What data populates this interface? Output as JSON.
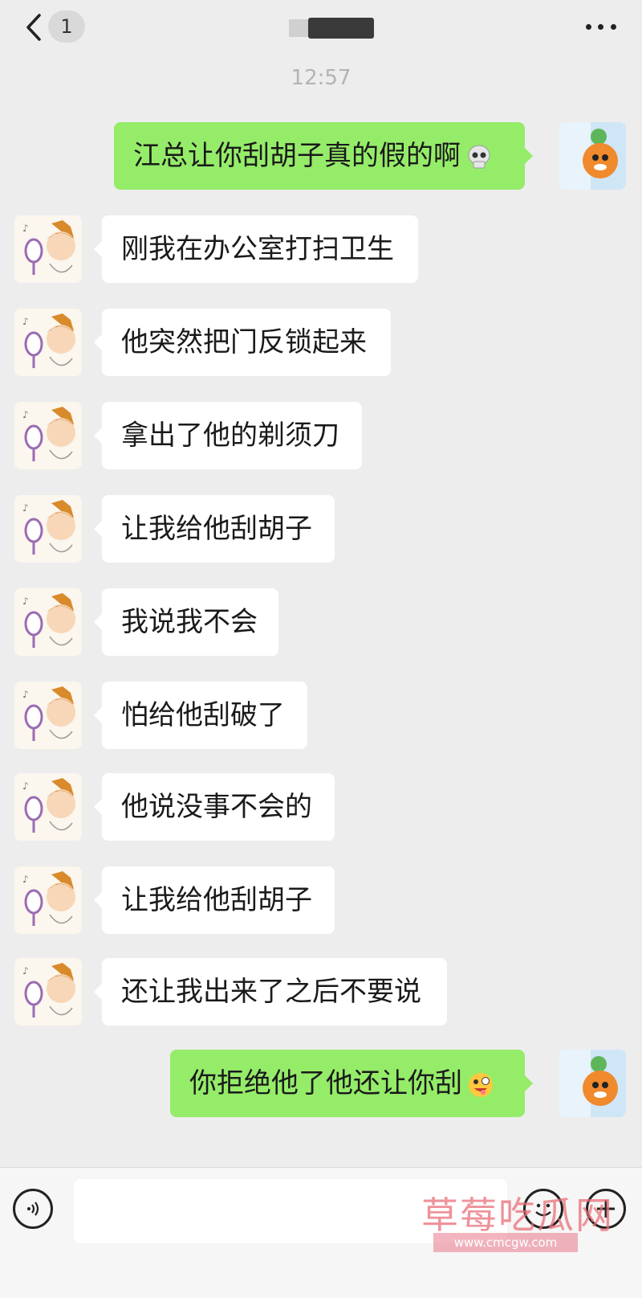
{
  "header": {
    "unread_count": "1"
  },
  "timestamp": "12:57",
  "messages": [
    {
      "sender": "me",
      "text": "江总让你刮胡子真的假的啊",
      "emoji": "skull-emoji"
    },
    {
      "sender": "other",
      "text": "刚我在办公室打扫卫生"
    },
    {
      "sender": "other",
      "text": "他突然把门反锁起来"
    },
    {
      "sender": "other",
      "text": "拿出了他的剃须刀"
    },
    {
      "sender": "other",
      "text": "让我给他刮胡子"
    },
    {
      "sender": "other",
      "text": "我说我不会"
    },
    {
      "sender": "other",
      "text": "怕给他刮破了"
    },
    {
      "sender": "other",
      "text": "他说没事不会的"
    },
    {
      "sender": "other",
      "text": "让我给他刮胡子"
    },
    {
      "sender": "other",
      "text": "还让我出来了之后不要说"
    },
    {
      "sender": "me",
      "text": "你拒绝他了他还让你刮",
      "emoji": "zany-face-emoji"
    }
  ],
  "input": {
    "value": ""
  },
  "watermark": {
    "title": "草莓吃瓜网",
    "url": "www.cmcgw.com"
  },
  "colors": {
    "background": "#ededed",
    "my_bubble": "#95ec69",
    "their_bubble": "#ffffff"
  }
}
